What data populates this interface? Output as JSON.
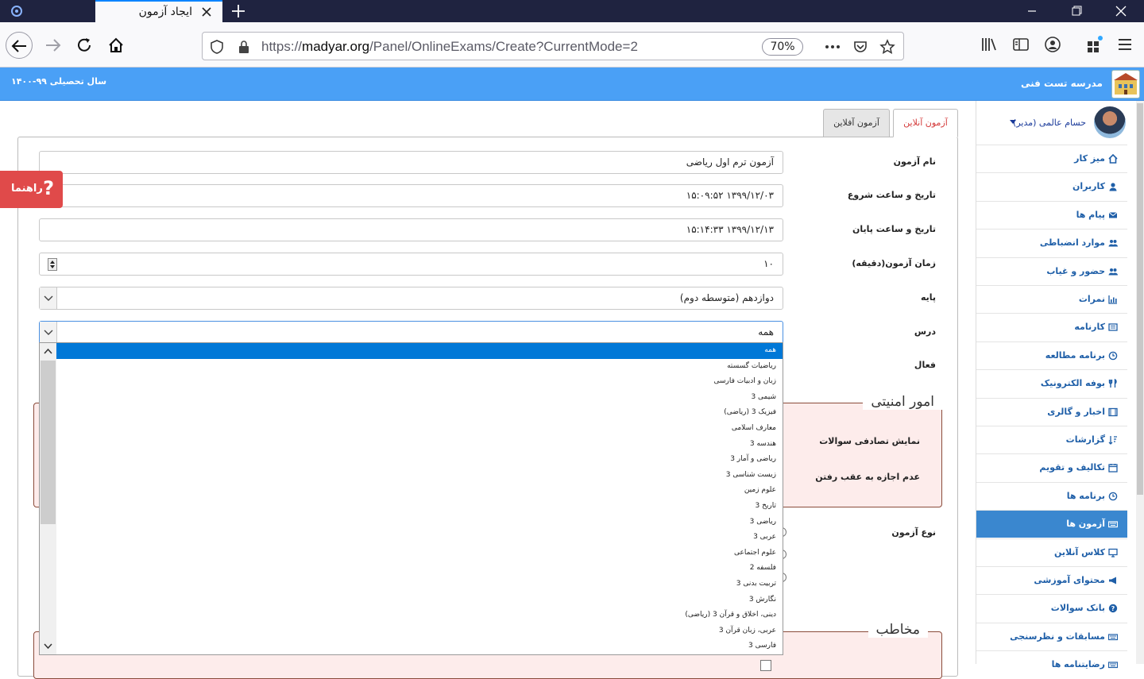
{
  "browser": {
    "tab_title": "ایجاد آزمون",
    "url_prefix": "https://",
    "url_domain": "madyar.org",
    "url_path": "/Panel/OnlineExams/Create?CurrentMode=2",
    "zoom": "70%"
  },
  "header": {
    "school_name": "مدرسه تست فنی",
    "academic_year": "سال تحصیلی ۹۹-۱۴۰۰"
  },
  "sidebar": {
    "user_name": "حسام عالمی (مدیر)",
    "items": [
      {
        "label": "میز کار",
        "icon": "home-icon"
      },
      {
        "label": "کاربران",
        "icon": "user-icon"
      },
      {
        "label": "پیام ها",
        "icon": "envelope-icon"
      },
      {
        "label": "موارد انضباطی",
        "icon": "users-icon"
      },
      {
        "label": "حضور و غیاب",
        "icon": "users-icon"
      },
      {
        "label": "نمرات",
        "icon": "bar-chart-icon"
      },
      {
        "label": "کارنامه",
        "icon": "list-icon"
      },
      {
        "label": "برنامه مطالعه",
        "icon": "clock-icon"
      },
      {
        "label": "بوفه الکترونیک",
        "icon": "utensils-icon"
      },
      {
        "label": "اخبار و گالری",
        "icon": "film-icon"
      },
      {
        "label": "گزارشات",
        "icon": "sort-icon"
      },
      {
        "label": "تکالیف و تقویم",
        "icon": "calendar-icon"
      },
      {
        "label": "برنامه ها",
        "icon": "clock-icon"
      },
      {
        "label": "آزمون ها",
        "icon": "keyboard-icon",
        "active": true
      },
      {
        "label": "کلاس آنلاین",
        "icon": "desktop-icon"
      },
      {
        "label": "محتوای آموزشی",
        "icon": "bullhorn-icon"
      },
      {
        "label": "بانک سوالات",
        "icon": "question-icon"
      },
      {
        "label": "مسابقات و نظرسنجی",
        "icon": "keyboard-icon"
      },
      {
        "label": "رضایتنامه ها",
        "icon": "keyboard-icon"
      }
    ]
  },
  "tabs": {
    "online": "آزمون آنلاین",
    "offline": "آزمون آفلاین"
  },
  "form": {
    "exam_name_label": "نام آزمون",
    "exam_name_value": "آزمون ترم اول ریاضی",
    "start_label": "تاریخ و ساعت شروع",
    "start_value": "۱۳۹۹/۱۲/۰۳ ۱۵:۰۹:۵۲",
    "end_label": "تاریخ و ساعت پایان",
    "end_value": "۱۳۹۹/۱۲/۱۳ ۱۵:۱۴:۳۳",
    "duration_label": "زمان آزمون(دقیقه)",
    "duration_value": "۱۰",
    "grade_label": "پایه",
    "grade_value": "دوازدهم (متوسطه دوم)",
    "lesson_label": "درس",
    "lesson_value": "همه",
    "active_label": "فعال",
    "exam_type_label": "نوع آزمون"
  },
  "security": {
    "legend": "امور امنیتی",
    "random_label": "نمایش تصادفی سوالات",
    "no_back_label": "عدم اجازه به عقب رفتن"
  },
  "audience": {
    "legend": "مخاطب"
  },
  "help": {
    "label": "راهنما",
    "icon": "?"
  },
  "lesson_options": [
    "همه",
    "ریاضیات گسسته",
    "زبان و ادبیات فارسی",
    "شیمی 3",
    "فیزیک 3 (ریاضی)",
    "معارف اسلامی",
    "هندسه 3",
    "ریاضی و آمار 3",
    "زیست شناسی 3",
    "علوم زمین",
    "تاریخ 3",
    "ریاضی 3",
    "عربی 3",
    "علوم اجتماعی",
    "فلسفه 2",
    "تربیت بدنی 3",
    "نگارش 3",
    "دینی، اخلاق و قرآن 3 (ریاضی)",
    "عربی، زبان قرآن 3",
    "فارسی 3"
  ],
  "colors": {
    "header_blue": "#4aa0f6",
    "sidebar_active": "#3a87cf",
    "selected_option": "#0078d7",
    "help_red": "#e04a4a",
    "fieldset_bg": "#fdeceb"
  }
}
